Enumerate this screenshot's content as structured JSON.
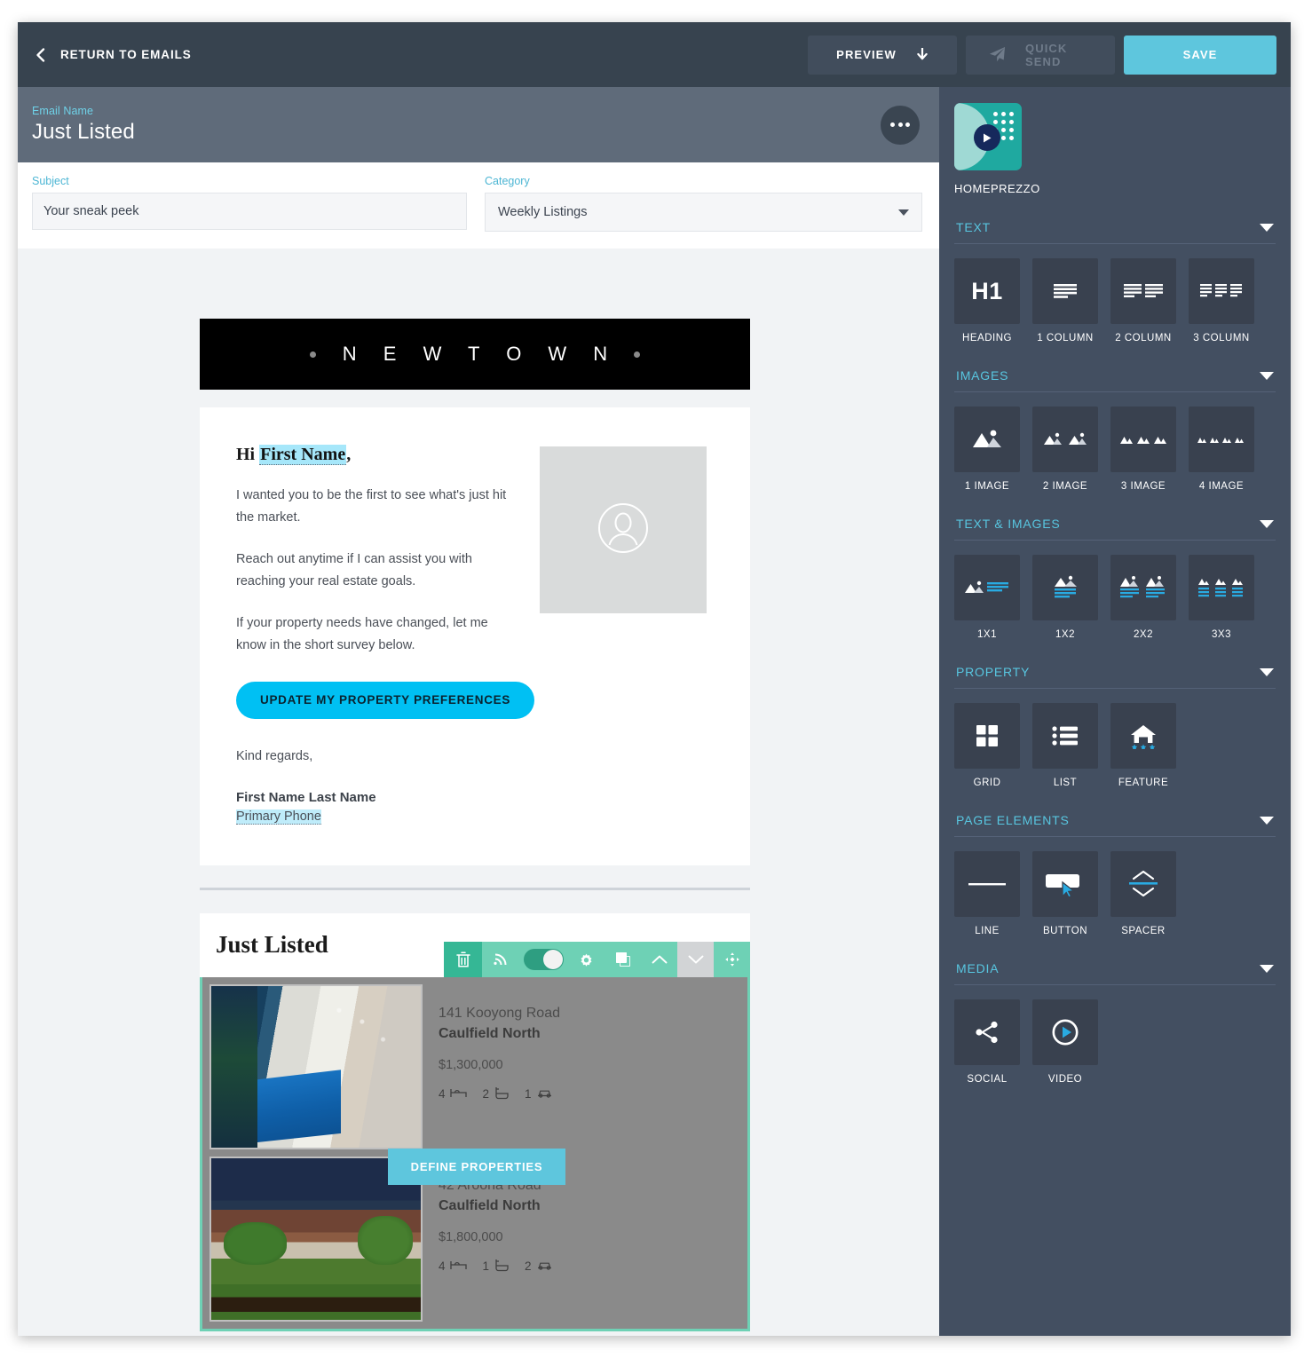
{
  "topbar": {
    "return_label": "RETURN TO EMAILS",
    "back_icon": "chevron-left-icon",
    "preview_label": "PREVIEW",
    "preview_icon": "arrow-down-icon",
    "quick_send_label": "QUICK SEND",
    "quick_send_icon": "paper-plane-icon",
    "save_label": "SAVE",
    "save_color": "#5ec6dd"
  },
  "namebar": {
    "label": "Email Name",
    "title": "Just Listed",
    "menu_icon": "ellipsis-icon"
  },
  "fields": {
    "subject_label": "Subject",
    "subject_value": "Your sneak peek",
    "subject_placeholder": "Your sneak peek",
    "category_label": "Category",
    "category_value": "Weekly Listings",
    "category_caret_icon": "caret-down-icon"
  },
  "email": {
    "brand": "N E W T O W N",
    "brand_dot_icon": "dot-icon",
    "greeting_prefix": "Hi ",
    "greeting_tag": "First Name",
    "greeting_suffix": ",",
    "paragraphs": [
      "I wanted you to be the first to see what's just hit the market.",
      "Reach out anytime if I can assist you with reaching your real estate goals.",
      "If your property needs have changed, let me know in the short survey below."
    ],
    "avatar_icon": "user-avatar-icon",
    "cta_label": "UPDATE MY PROPERTY PREFERENCES",
    "cta_color": "#00c0f3",
    "signoff": "Kind regards,",
    "signature_name": "First Name Last Name",
    "signature_phone": "Primary Phone"
  },
  "just_listed": {
    "title": "Just Listed",
    "toolbar": [
      {
        "name": "delete-icon",
        "label": "Delete"
      },
      {
        "name": "rss-feed-icon",
        "label": "Feed"
      },
      {
        "name": "toggle-switch",
        "label": "Enabled"
      },
      {
        "name": "settings-gear-icon",
        "label": "Settings"
      },
      {
        "name": "duplicate-icon",
        "label": "Duplicate"
      },
      {
        "name": "chevron-up-icon",
        "label": "Move up"
      },
      {
        "name": "chevron-down-icon",
        "label": "Move down"
      },
      {
        "name": "move-icon",
        "label": "Drag"
      }
    ],
    "define_button_label": "DEFINE PROPERTIES",
    "define_button_color": "#5ec6dd",
    "accent_color": "#6ed1b5",
    "properties": [
      {
        "street": "141 Kooyong Road",
        "suburb": "Caulfield North",
        "price": "$1,300,000",
        "beds": "4",
        "baths": "2",
        "cars": "1",
        "photo": "modern-house-pool-photo"
      },
      {
        "street": "42 Aroona Road",
        "suburb": "Caulfield North",
        "price": "$1,800,000",
        "beds": "4",
        "baths": "1",
        "cars": "2",
        "photo": "brick-house-garden-photo"
      }
    ]
  },
  "sidebar": {
    "logo_name": "HOMEPREZZO",
    "logo_icon": "play-tile-icon",
    "sections": [
      {
        "title": "TEXT",
        "caret_icon": "caret-down-icon",
        "tiles": [
          {
            "label": "HEADING",
            "icon": "heading-h1-icon"
          },
          {
            "label": "1 COLUMN",
            "icon": "one-column-icon"
          },
          {
            "label": "2 COLUMN",
            "icon": "two-column-icon"
          },
          {
            "label": "3 COLUMN",
            "icon": "three-column-icon"
          }
        ]
      },
      {
        "title": "IMAGES",
        "caret_icon": "caret-down-icon",
        "tiles": [
          {
            "label": "1 IMAGE",
            "icon": "one-image-icon"
          },
          {
            "label": "2 IMAGE",
            "icon": "two-image-icon"
          },
          {
            "label": "3 IMAGE",
            "icon": "three-image-icon"
          },
          {
            "label": "4 IMAGE",
            "icon": "four-image-icon"
          }
        ]
      },
      {
        "title": "TEXT & IMAGES",
        "caret_icon": "caret-down-icon",
        "tiles": [
          {
            "label": "1X1",
            "icon": "image-text-1x1-icon"
          },
          {
            "label": "1X2",
            "icon": "image-text-1x2-icon"
          },
          {
            "label": "2X2",
            "icon": "image-text-2x2-icon"
          },
          {
            "label": "3X3",
            "icon": "image-text-3x3-icon"
          }
        ]
      },
      {
        "title": "PROPERTY",
        "caret_icon": "caret-down-icon",
        "tiles": [
          {
            "label": "GRID",
            "icon": "grid-icon"
          },
          {
            "label": "LIST",
            "icon": "list-icon"
          },
          {
            "label": "FEATURE",
            "icon": "house-stars-icon"
          }
        ]
      },
      {
        "title": "PAGE ELEMENTS",
        "caret_icon": "caret-down-icon",
        "tiles": [
          {
            "label": "LINE",
            "icon": "horizontal-line-icon"
          },
          {
            "label": "BUTTON",
            "icon": "button-cursor-icon"
          },
          {
            "label": "SPACER",
            "icon": "spacer-icon"
          }
        ]
      },
      {
        "title": "MEDIA",
        "caret_icon": "caret-down-icon",
        "tiles": [
          {
            "label": "SOCIAL",
            "icon": "share-icon"
          },
          {
            "label": "VIDEO",
            "icon": "play-circle-icon"
          }
        ]
      }
    ]
  }
}
